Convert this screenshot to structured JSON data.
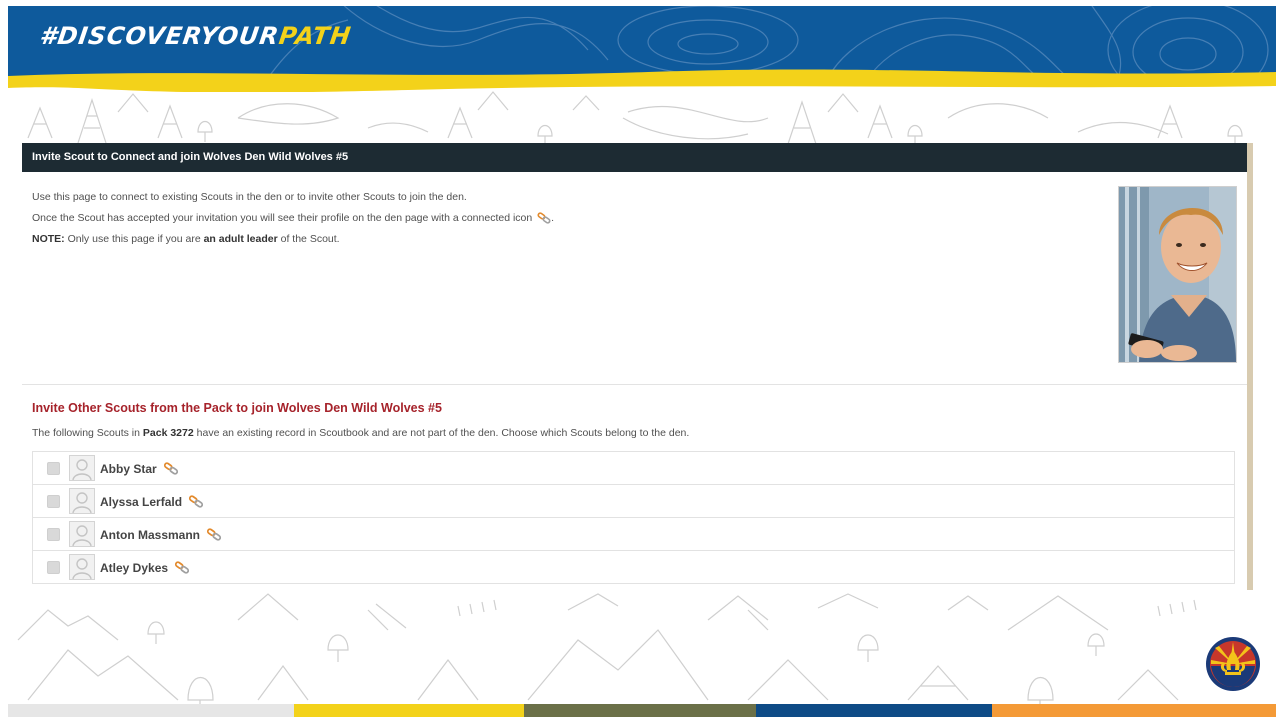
{
  "slide": {
    "hashtag_main": "#DISCOVERYOUR",
    "hashtag_accent": "PATH"
  },
  "page": {
    "header_title": "Invite Scout to Connect and join Wolves Den Wild Wolves #5",
    "info_line1": "Use this page to connect to existing Scouts in the den or to invite other Scouts to join the den.",
    "info_line2": "Once the Scout has accepted your invitation you will see their profile on the den page with a connected icon",
    "note_label": "NOTE:",
    "note_part1": "Only use this page if you are",
    "note_bold": "an adult leader",
    "note_part2": "of the Scout.",
    "invite_title": "Invite Other Scouts from the Pack to join Wolves Den Wild Wolves #5",
    "desc_part1": "The following Scouts in",
    "desc_pack": "Pack 3272",
    "desc_part2": "have an existing record in Scoutbook and are not part of the den. Choose which Scouts belong to the den.",
    "scouts": [
      {
        "name": "Abby Star"
      },
      {
        "name": "Alyssa Lerfald"
      },
      {
        "name": "Anton Massmann"
      },
      {
        "name": "Atley Dykes"
      }
    ]
  },
  "colors": {
    "banner_blue": "#0e5a9c",
    "stripe_yellow": "#f3d21a",
    "header_dark": "#1d2b33",
    "title_red": "#a6232b",
    "link_orange": "#e38a2c"
  },
  "icons": {
    "connected": "link-chain-icon",
    "avatar": "user-silhouette-icon",
    "logo": "council-fleur-de-lis-icon"
  }
}
